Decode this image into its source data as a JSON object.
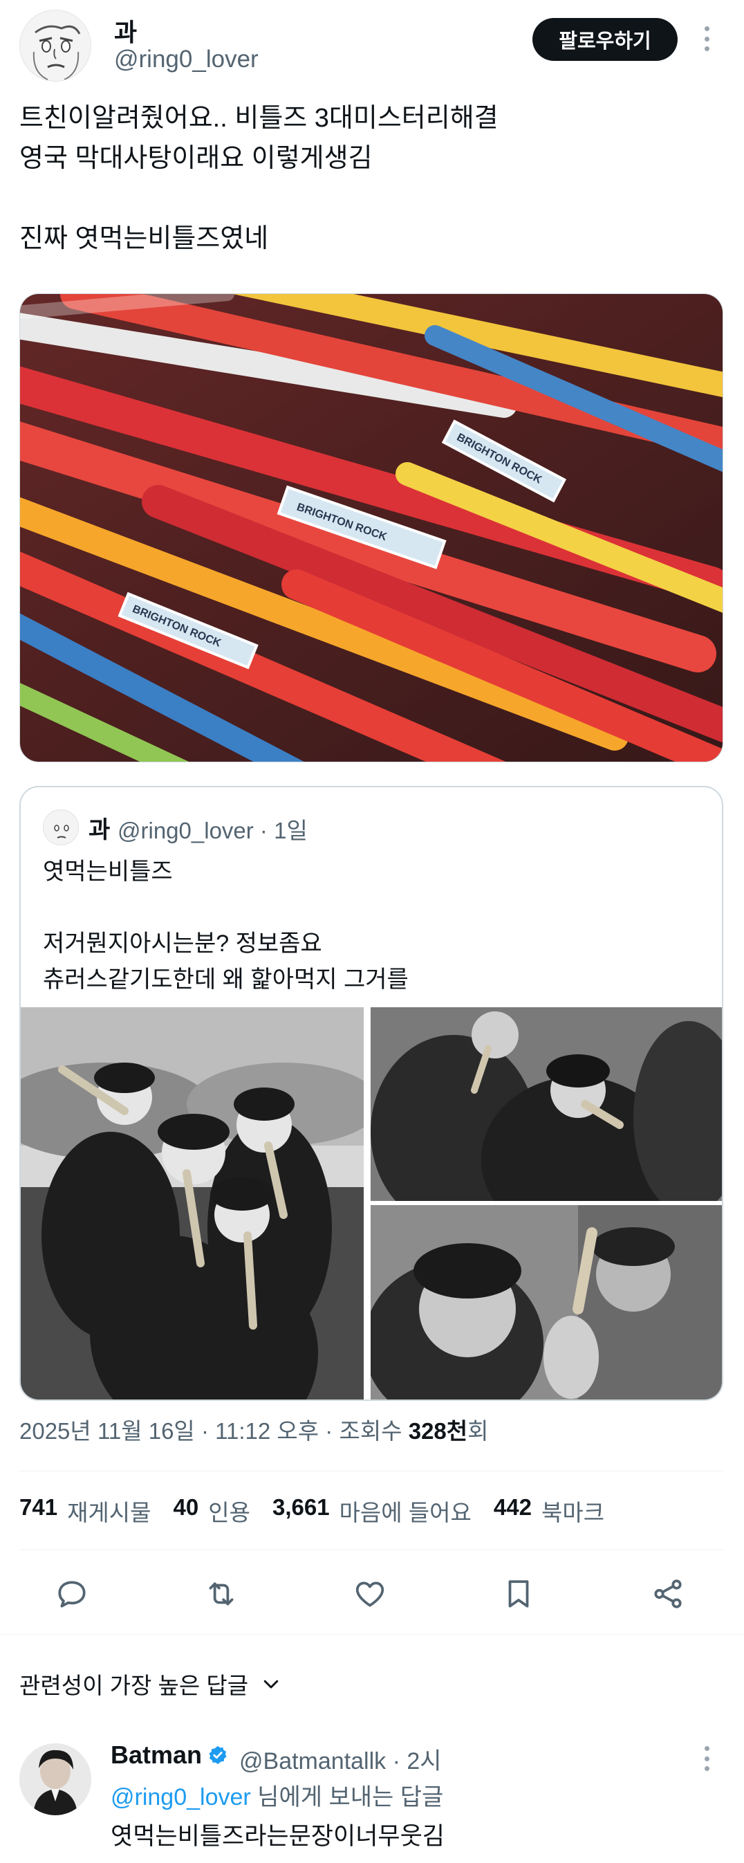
{
  "author": {
    "name": "과",
    "handle": "@ring0_lover",
    "follow_label": "팔로우하기"
  },
  "tweet": {
    "text": "트친이알려줬어요.. 비틀즈 3대미스터리해결\n영국 막대사탕이래요 이렇게생김\n\n진짜 엿먹는비틀즈였네",
    "photo_labels": [
      "BRIGHTON ROCK",
      "BRIGHTON ROCK",
      "BRIGHTON ROCK"
    ]
  },
  "quote": {
    "name": "과",
    "handle_time": "@ring0_lover · 1일",
    "text": "엿먹는비틀즈\n\n저거뭔지아시는분? 정보좀요\n츄러스같기도한데 왜 핥아먹지 그거를"
  },
  "meta": {
    "datetime": "2025년 11월 16일 · 11:12 오후 · 조회수 ",
    "views": "328천",
    "views_suffix": "회"
  },
  "stats": [
    {
      "num": "741",
      "label": "재게시물"
    },
    {
      "num": "40",
      "label": "인용"
    },
    {
      "num": "3,661",
      "label": "마음에 들어요"
    },
    {
      "num": "442",
      "label": "북마크"
    }
  ],
  "actions": {
    "reply": "reply-icon",
    "repost": "repost-icon",
    "like": "heart-icon",
    "bookmark": "bookmark-icon",
    "share": "share-icon"
  },
  "replies_sort": {
    "label": "관련성이 가장 높은 답글"
  },
  "reply": {
    "name": "Batman",
    "handle_time": "@Batmantallk · 2시",
    "to_link": "@ring0_lover",
    "to_suffix": " 님에게 보내는 답글",
    "text": "엿먹는비틀즈라는문장이너무웃김"
  },
  "colors": {
    "accent": "#1d9bf0",
    "text": "#0f1419",
    "muted": "#536471",
    "border": "#cfd9de"
  }
}
